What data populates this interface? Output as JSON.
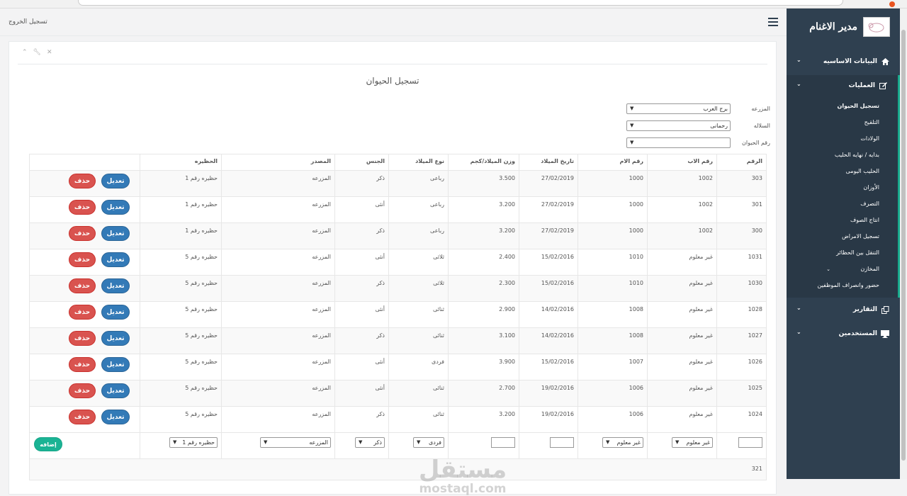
{
  "app": {
    "title": "مدير الاغنام",
    "logout": "تسجيل الخروج"
  },
  "sidebar": {
    "items": [
      {
        "label": "البيانات الاساسيه",
        "icon": "home-icon"
      },
      {
        "label": "العمليات",
        "icon": "edit-icon"
      },
      {
        "label": "التقارير",
        "icon": "copy-icon"
      },
      {
        "label": "المستخدمين",
        "icon": "desktop-icon"
      }
    ],
    "subitems": [
      {
        "label": "تسجيل الحيوان",
        "current": true
      },
      {
        "label": "التلقيح"
      },
      {
        "label": "الولادات"
      },
      {
        "label": "بدايه / نهايه الحليب"
      },
      {
        "label": "الحليب اليومى"
      },
      {
        "label": "الأوزان"
      },
      {
        "label": "التصرف"
      },
      {
        "label": "انتاج الصوف"
      },
      {
        "label": "تسجيل الامراض"
      },
      {
        "label": "التنقل بين الحظائر"
      },
      {
        "label": "المخازن"
      },
      {
        "label": "حضور وانصراف الموظفين"
      }
    ]
  },
  "page": {
    "title": "تسجيل الحيوان",
    "filters": {
      "farm_label": "المزرعه",
      "farm_value": "برج العرب",
      "breed_label": "السلاله",
      "breed_value": "رحمانى",
      "animal_label": "رقم الحيوان",
      "animal_value": ""
    }
  },
  "table": {
    "headers": [
      "الرقم",
      "رقم الاب",
      "رقم الام",
      "تاريخ الميلاد",
      "وزن الميلاد/كجم",
      "نوع الميلاد",
      "الجنس",
      "المصدر",
      "الحظيره",
      ""
    ],
    "edit_label": "تعديل",
    "delete_label": "حذف",
    "rows": [
      [
        "303",
        "1002",
        "1000",
        "27/02/2019",
        "3.500",
        "رباعى",
        "ذكر",
        "المزرعه",
        "حظيره رقم 1"
      ],
      [
        "301",
        "1002",
        "1000",
        "27/02/2019",
        "3.200",
        "رباعى",
        "أنثى",
        "المزرعه",
        "حظيره رقم 1"
      ],
      [
        "300",
        "1002",
        "1000",
        "27/02/2019",
        "3.200",
        "رباعى",
        "ذكر",
        "المزرعه",
        "حظيره رقم 1"
      ],
      [
        "1031",
        "غير معلوم",
        "1010",
        "15/02/2016",
        "2.400",
        "ثلاثى",
        "أنثى",
        "المزرعه",
        "حظيره رقم 5"
      ],
      [
        "1030",
        "غير معلوم",
        "1010",
        "15/02/2016",
        "2.300",
        "ثلاثى",
        "ذكر",
        "المزرعه",
        "حظيره رقم 5"
      ],
      [
        "1028",
        "غير معلوم",
        "1008",
        "14/02/2016",
        "2.900",
        "ثنائى",
        "أنثى",
        "المزرعه",
        "حظيره رقم 5"
      ],
      [
        "1027",
        "غير معلوم",
        "1008",
        "14/02/2016",
        "3.100",
        "ثنائى",
        "ذكر",
        "المزرعه",
        "حظيره رقم 5"
      ],
      [
        "1026",
        "غير معلوم",
        "1007",
        "15/02/2016",
        "3.900",
        "فردى",
        "أنثى",
        "المزرعه",
        "حظيره رقم 5"
      ],
      [
        "1025",
        "غير معلوم",
        "1006",
        "19/02/2016",
        "2.700",
        "ثنائى",
        "أنثى",
        "المزرعه",
        "حظيره رقم 5"
      ],
      [
        "1024",
        "غير معلوم",
        "1006",
        "19/02/2016",
        "3.200",
        "ثنائى",
        "ذكر",
        "المزرعه",
        "حظيره رقم 5"
      ]
    ],
    "new_row": {
      "father": "غير معلوم",
      "mother": "غير معلوم",
      "birth_type": "فردى",
      "gender": "ذكر",
      "source": "المزرعه",
      "barn": "حظيره رقم 1",
      "add_label": "إضافه"
    },
    "footer_count": "321"
  },
  "watermark": {
    "main": "مستقل",
    "sub": "mostaql.com"
  }
}
